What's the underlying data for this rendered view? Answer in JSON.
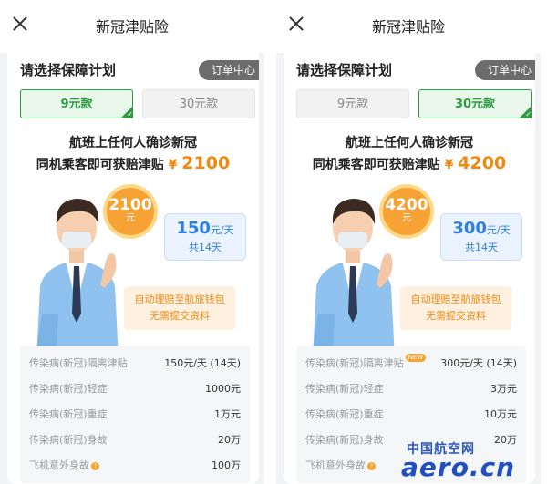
{
  "screens": [
    {
      "title": "新冠津贴险",
      "section_title": "请选择保障计划",
      "orders_label": "订单中心",
      "plans": [
        {
          "label": "9元款",
          "selected": true
        },
        {
          "label": "30元款",
          "selected": false
        }
      ],
      "headline_1": "航班上任何人确诊新冠",
      "headline_2_prefix": "同机乘客即可获赔津贴",
      "yen": "¥",
      "amount": "2100",
      "coin_value": "2100",
      "coin_unit": "元",
      "rate_value": "150",
      "rate_unit": "元/天",
      "rate_days": "共14天",
      "auto_line_1": "自动理赔至航旅钱包",
      "auto_line_2": "无需提交资料",
      "benefits": [
        {
          "label": "传染病(新冠)隔离津贴",
          "value": "150元/天 (14天)",
          "badge": ""
        },
        {
          "label": "传染病(新冠)轻症",
          "value": "1000元",
          "badge": ""
        },
        {
          "label": "传染病(新冠)重症",
          "value": "1万元",
          "badge": ""
        },
        {
          "label": "传染病(新冠)身故",
          "value": "20万",
          "badge": ""
        },
        {
          "label": "飞机意外身故",
          "value": "100万",
          "badge": "dot"
        }
      ]
    },
    {
      "title": "新冠津贴险",
      "section_title": "请选择保障计划",
      "orders_label": "订单中心",
      "plans": [
        {
          "label": "9元款",
          "selected": false
        },
        {
          "label": "30元款",
          "selected": true
        }
      ],
      "headline_1": "航班上任何人确诊新冠",
      "headline_2_prefix": "同机乘客即可获赔津贴",
      "yen": "¥",
      "amount": "4200",
      "coin_value": "4200",
      "coin_unit": "元",
      "rate_value": "300",
      "rate_unit": "元/天",
      "rate_days": "共14天",
      "auto_line_1": "自动理赔至航旅钱包",
      "auto_line_2": "无需提交资料",
      "benefits": [
        {
          "label": "传染病(新冠)隔离津贴",
          "value": "300元/天 (14天)",
          "badge": "NEW"
        },
        {
          "label": "传染病(新冠)轻症",
          "value": "3万元",
          "badge": ""
        },
        {
          "label": "传染病(新冠)重症",
          "value": "10万元",
          "badge": ""
        },
        {
          "label": "传染病(新冠)身故",
          "value": "20万",
          "badge": ""
        },
        {
          "label": "飞机意外身故",
          "value": "",
          "badge": "dot"
        }
      ]
    }
  ],
  "watermark": {
    "cn": "中国航空网",
    "en": "aero.cn"
  },
  "colors": {
    "accent_green": "#2f9a45",
    "accent_orange": "#f08a12",
    "accent_blue": "#2d7fe0"
  }
}
